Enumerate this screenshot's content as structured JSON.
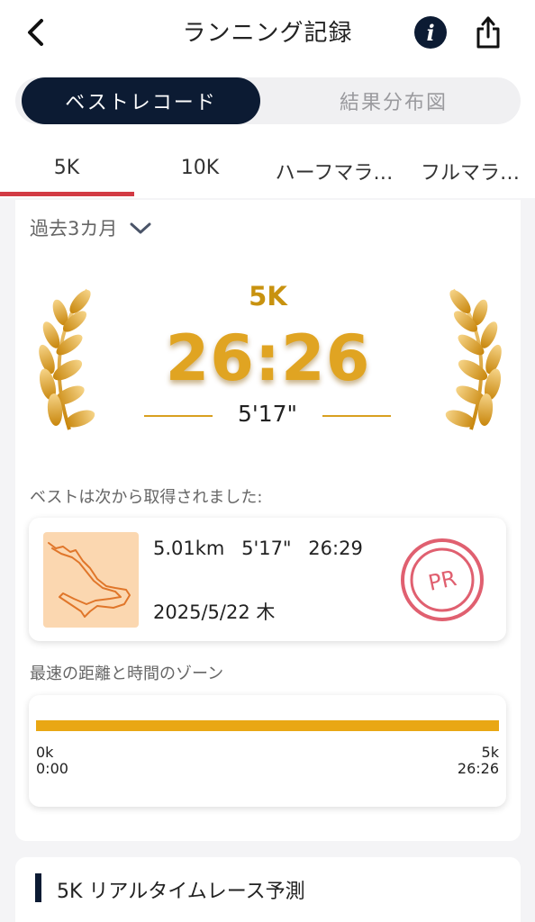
{
  "header": {
    "title": "ランニング記録",
    "info_icon": "info-icon",
    "share_icon": "share-icon",
    "back_icon": "chevron-left-icon"
  },
  "segment": {
    "active_label": "ベストレコード",
    "inactive_label": "結果分布図"
  },
  "tabs": [
    {
      "label": "5K",
      "selected": true
    },
    {
      "label": "10K",
      "selected": false
    },
    {
      "label": "ハーフマラ…",
      "selected": false
    },
    {
      "label": "フルマラ…",
      "selected": false
    }
  ],
  "best": {
    "period_label": "過去3カ月",
    "distance": "5K",
    "time": "26:26",
    "pace": "5'17\""
  },
  "source": {
    "label": "ベストは次から取得されました:",
    "distance": "5.01km",
    "pace": "5'17\"",
    "time": "26:29",
    "date": "2025/5/22 木",
    "badge": "PR"
  },
  "zone": {
    "title": "最速の距離と時間のゾーン",
    "start_distance": "0k",
    "start_time": "0:00",
    "end_distance": "5k",
    "end_time": "26:26",
    "fill_fraction": 1.0
  },
  "prediction": {
    "title": "5K リアルタイムレース予測"
  },
  "colors": {
    "navy": "#0c1b33",
    "gold": "#e0a422",
    "accent_red": "#d23a44",
    "bar": "#e9a714",
    "pr_red": "#e06070"
  }
}
